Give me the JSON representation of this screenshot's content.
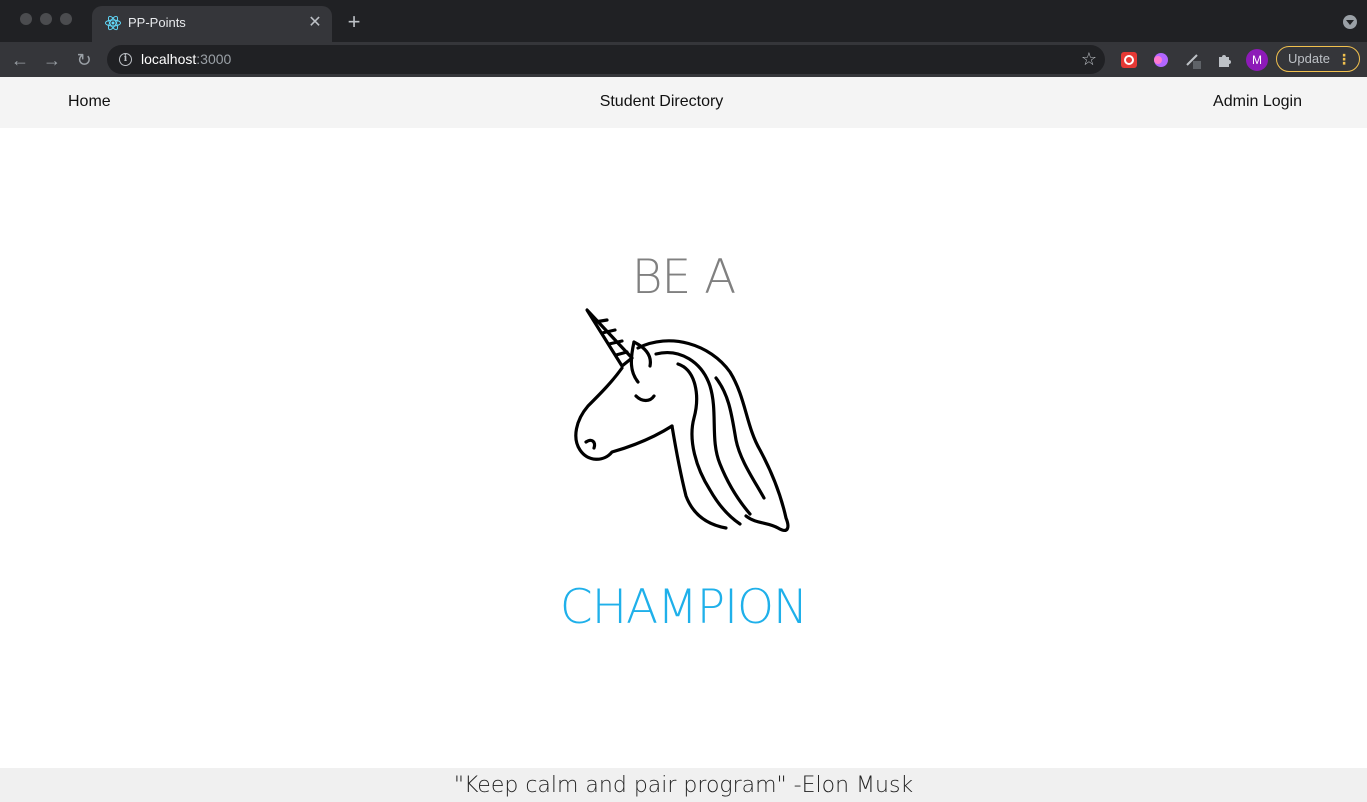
{
  "browser": {
    "tab_title": "PP-Points",
    "url_host": "localhost",
    "url_port": ":3000",
    "profile_initial": "M",
    "update_label": "Update",
    "close_glyph": "✕",
    "new_tab_glyph": "+",
    "back_glyph": "←",
    "forward_glyph": "→",
    "reload_glyph": "↻",
    "star_glyph": "☆",
    "info_glyph": "i",
    "menu_glyph": "⋮"
  },
  "navbar": {
    "home": "Home",
    "directory": "Student Directory",
    "admin": "Admin Login"
  },
  "hero": {
    "pre": "BE A",
    "main": "CHAMPION",
    "main_color": "#1fb0ea",
    "pre_color": "#808080"
  },
  "footer": {
    "quote": "\"Keep calm and pair program\" -Elon Musk"
  }
}
